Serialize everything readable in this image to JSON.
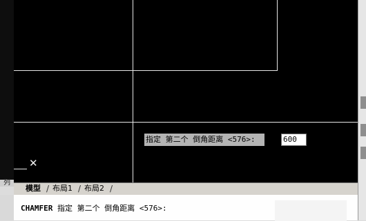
{
  "left_panel": {
    "label": "列"
  },
  "dynamic_input": {
    "prompt": "指定 第二个 倒角距离 <576>:",
    "value": "600"
  },
  "layout_tabs": [
    {
      "label": "模型",
      "active": true
    },
    {
      "label": "布局1",
      "active": false
    },
    {
      "label": "布局2",
      "active": false
    }
  ],
  "command_line": {
    "command": "CHAMFER",
    "prompt": "指定 第二个 倒角距离 <576>:"
  },
  "colors": {
    "canvas": "#000000",
    "geometry": "#e8e8e8",
    "tooltip_bg": "#b4b4b4",
    "tab_bar": "#d6d3cd"
  }
}
